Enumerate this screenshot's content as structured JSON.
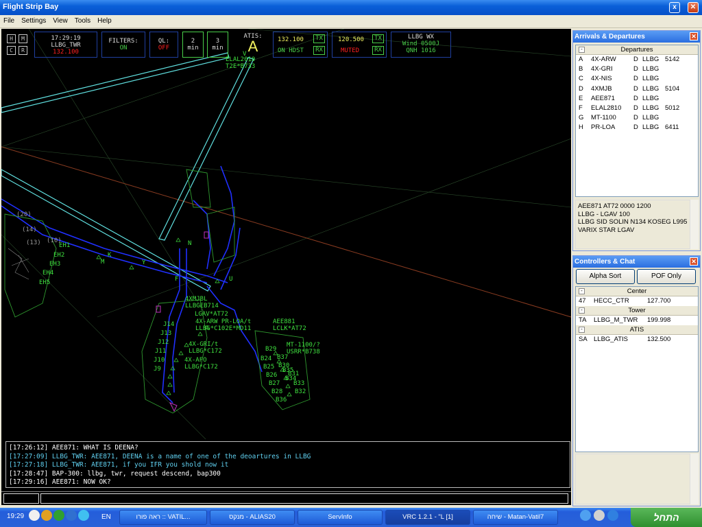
{
  "window": {
    "title": "Flight Strip Bay"
  },
  "menu": {
    "items": [
      "File",
      "Settings",
      "View",
      "Tools",
      "Help"
    ]
  },
  "toolbar": {
    "buttons_hm": [
      "H",
      "M"
    ],
    "buttons_cr": [
      "C",
      "R"
    ],
    "time": "17:29:19",
    "position": "LLBG_TWR",
    "prim_freq": "132.100",
    "filters_label": "FILTERS:",
    "filters_value": "ON",
    "ql_label": "QL:",
    "ql_value": "OFF",
    "timer1": [
      "2",
      "min"
    ],
    "timer2": [
      "3",
      "min"
    ],
    "atis_label": "ATIS:",
    "atis_letter": "A",
    "com1_freq": "132.100",
    "com1_status": "ON HDST",
    "com2_freq": "120.500",
    "com2_status": "MUTED",
    "tx": "TX",
    "rx": "RX",
    "wx_station": "LLBG WX",
    "wx_wind": "Wind 0500J",
    "wx_qnh": "QNH 1016"
  },
  "radar_labels": {
    "top_tag1": "ELAL2010",
    "top_tag2": "T2E*B733",
    "taxiways": [
      "(20)",
      "(14)",
      "(13)",
      "(10)",
      "EH1",
      "EH2",
      "EH3",
      "EH4",
      "EH5",
      "K",
      "M",
      "Y",
      "N",
      "F",
      "U",
      "V",
      "J14",
      "J13",
      "J12",
      "J11",
      "J10",
      "J9",
      "B29",
      "B37",
      "B30",
      "B31",
      "B32",
      "B33",
      "B34",
      "B35",
      "B36",
      "B28",
      "B27",
      "B26",
      "B25",
      "B24"
    ],
    "tags": [
      {
        "l1": "4XMJBL",
        "l2": "LLBGEB714"
      },
      {
        "l1": "LGAV*AT72",
        "l2": ""
      },
      {
        "l1": "4X-ARW PR-LOA/t",
        "l2": "LLBG*C102E*MD11"
      },
      {
        "l1": "AEE881",
        "l2": "LCLK*AT72"
      },
      {
        "l1": "4X-GRI/t",
        "l2": "LLBG*C172"
      },
      {
        "l1": "MT-1100/?",
        "l2": "USRR*B738"
      },
      {
        "l1": "4X-AFO",
        "l2": "LLBG*C172"
      }
    ]
  },
  "chat": {
    "lines": [
      {
        "text": "[17:26:12] AEE871: WHAT IS DEENA?",
        "color": "#ffffff"
      },
      {
        "text": "[17:27:09] LLBG_TWR: AEE871, DEENA is a name of one of the deoartures in LLBG",
        "color": "#60d0f0"
      },
      {
        "text": "[17:27:18] LLBG_TWR: AEE871, if you IFR you shold now it",
        "color": "#60d0f0"
      },
      {
        "text": "[17:28:47] BAP-300: llbg, twr, request descend, bap300",
        "color": "#ffffff"
      },
      {
        "text": "[17:29:16] AEE871: NOW OK?",
        "color": "#ffffff"
      }
    ]
  },
  "arrdep": {
    "title": "Arrivals & Departures",
    "group": "Departures",
    "rows": [
      [
        "A",
        "4X-ARW",
        "D",
        "LLBG",
        "5142"
      ],
      [
        "B",
        "4X-GRI",
        "D",
        "LLBG",
        ""
      ],
      [
        "C",
        "4X-NIS",
        "D",
        "LLBG",
        ""
      ],
      [
        "D",
        "4XMJB",
        "D",
        "LLBG",
        "5104"
      ],
      [
        "E",
        "AEE871",
        "D",
        "LLBG",
        ""
      ],
      [
        "F",
        "ELAL2810",
        "D",
        "LLBG",
        "5012"
      ],
      [
        "G",
        "MT-1100",
        "D",
        "LLBG",
        ""
      ],
      [
        "H",
        "PR-LOA",
        "D",
        "LLBG",
        "6411"
      ]
    ],
    "detail": [
      "AEE871  AT72  0000  1200",
      "LLBG - LGAV  100",
      "LLBG SID SOLIN N134 KOSEG L995",
      "VARIX STAR LGAV"
    ]
  },
  "controllers": {
    "title": "Controllers & Chat",
    "alpha_sort": "Alpha Sort",
    "pof_only": "POF Only",
    "groups": [
      {
        "name": "Center",
        "rows": [
          [
            "47",
            "HECC_CTR",
            "127.700"
          ]
        ]
      },
      {
        "name": "Tower",
        "rows": [
          [
            "TA",
            "LLBG_M_TWR",
            "199.998"
          ]
        ]
      },
      {
        "name": "ATIS",
        "rows": [
          [
            "SA",
            "LLBG_ATIS",
            "132.500"
          ]
        ]
      }
    ]
  },
  "taskbar": {
    "clock": "19:29",
    "lang": "EN",
    "tasks": [
      "ראה פורו :: VATIL...",
      "מנקס - ALIAS20",
      "ServInfo",
      "VRC 1.2.1 - \"L [1]",
      "שיחה - Matan-Vatil7"
    ],
    "start": "התחל"
  },
  "colors": {
    "radar_bg": "#000000",
    "tag_green": "#3fe03f",
    "runway": "#60e0e0",
    "taxiway": "#2030ff",
    "title_blue": "#0a5fd8"
  }
}
